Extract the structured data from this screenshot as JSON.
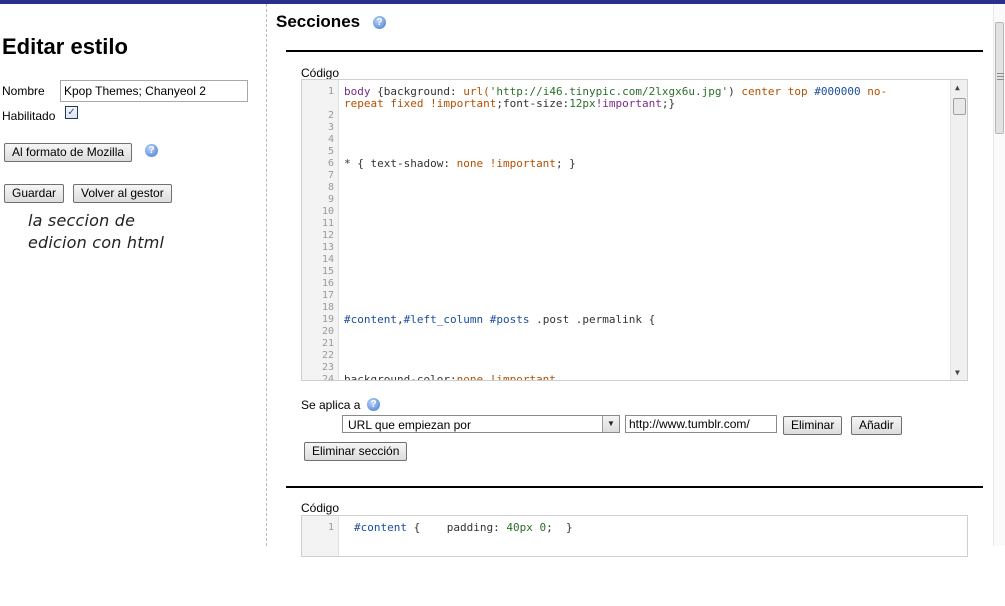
{
  "left": {
    "title": "Editar estilo",
    "name_label": "Nombre",
    "name_value": "Kpop Themes; Chanyeol 2",
    "enabled_label": "Habilitado",
    "enabled_checked": true,
    "mozilla_button": "Al formato de Mozilla",
    "save_button": "Guardar",
    "back_button": "Volver al gestor",
    "annotation_line1": "la seccion de",
    "annotation_line2": "edicion con html"
  },
  "sections": {
    "title": "Secciones",
    "section1": {
      "code_label": "Código",
      "line_numbers": [
        "1",
        "2",
        "3",
        "4",
        "5",
        "6",
        "7",
        "8",
        "9",
        "10",
        "11",
        "12",
        "13",
        "14",
        "15",
        "16",
        "17",
        "18",
        "19",
        "20",
        "21",
        "22",
        "23",
        "24"
      ],
      "line1_a": "body",
      "line1_b": " {background: ",
      "line1_c": "url(",
      "line1_d": "'http://i46.tinypic.com/2lxgx6u.jpg'",
      "line1_e": ") ",
      "line1_f": "center top ",
      "line1_g": "#000000",
      "line1_h": " no-",
      "line1_cont_a": "repeat fixed !important",
      "line1_cont_b": ";font-size:",
      "line1_cont_c": "12px",
      "line1_cont_d": "!important",
      "line1_cont_e": ";}",
      "line6_a": "* { text-shadow: ",
      "line6_b": "none !important",
      "line6_c": "; }",
      "line19_a": "#content",
      "line19_b": ",",
      "line19_c": "#left_column #posts",
      "line19_d": " .post .permalink {",
      "line24_a": "background-color:",
      "line24_b": "none !important"
    },
    "applies_label": "Se aplica a",
    "rule_select": "URL que empiezan por",
    "rule_url": "http://www.tumblr.com/",
    "delete_button": "Eliminar",
    "add_button": "Añadir",
    "delete_section_button": "Eliminar sección",
    "section2": {
      "code_label": "Código",
      "line_number": "1",
      "line_a": "#content",
      "line_b": " {    padding: ",
      "line_c": "40px 0",
      "line_d": ";  }"
    }
  }
}
